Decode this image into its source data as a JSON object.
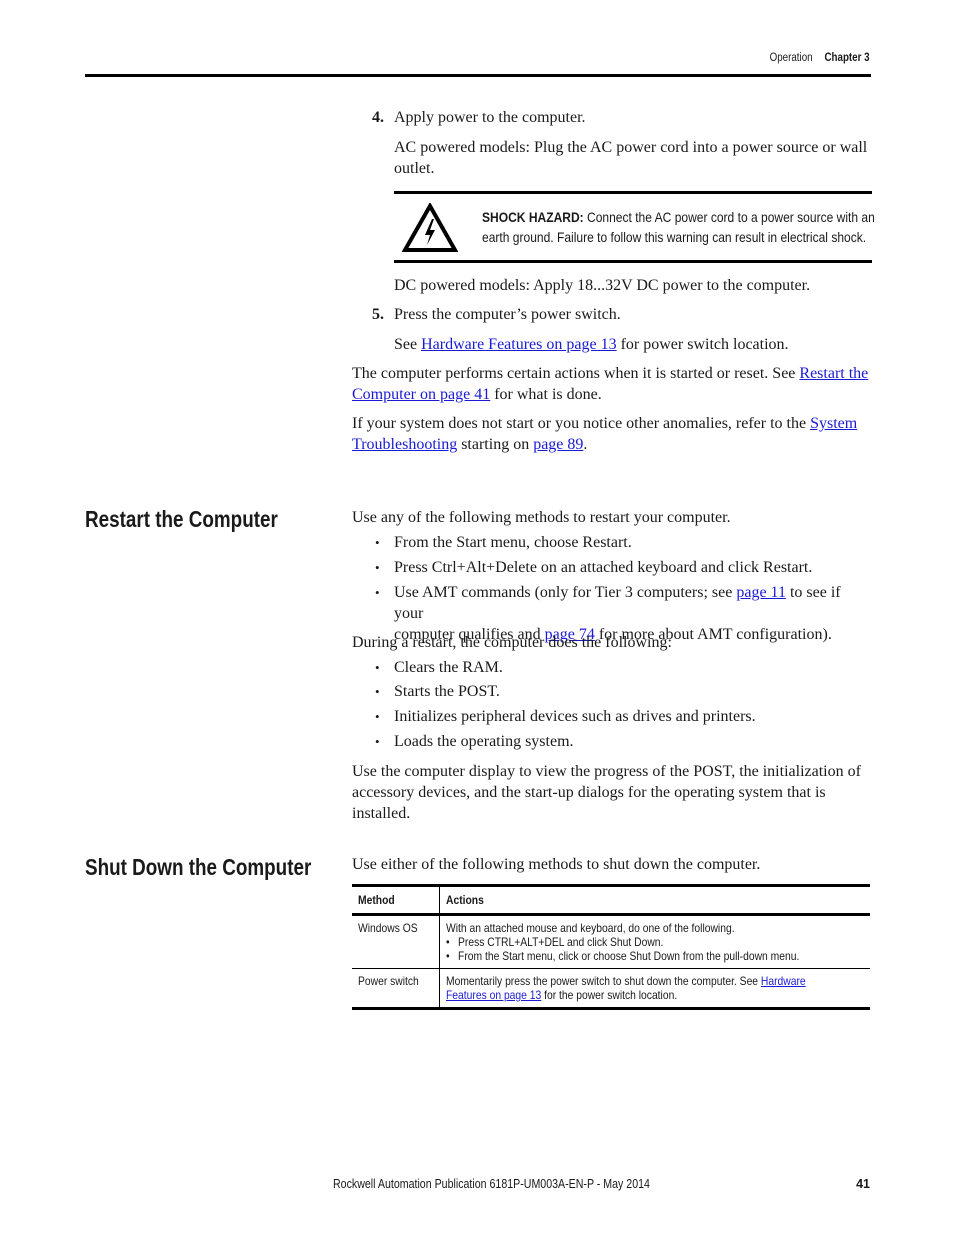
{
  "header": {
    "section": "Operation",
    "chapter": "Chapter 3"
  },
  "steps": {
    "step4": {
      "number": "4.",
      "text": "Apply power to the computer.",
      "ac_note": "AC powered models: Plug the AC power cord into a power source or wall outlet.",
      "hazard": {
        "icon": "shock-hazard-icon",
        "label": "SHOCK HAZARD:",
        "line1": " Connect the AC power cord to a power source with an",
        "line2": "earth ground. Failure to follow this warning can result in electrical shock."
      },
      "dc_note": "DC powered models: Apply 18...32V DC power to the computer."
    },
    "step5": {
      "number": "5.",
      "text": "Press the computer’s power switch.",
      "see_pre": "See ",
      "see_link": "Hardware Features on page 13",
      "see_post": " for power switch location."
    }
  },
  "para_actions": {
    "pre": "The computer performs certain actions when it is started or reset. See ",
    "link1": "Restart the",
    "link2": "Computer on page 41",
    "post": " for what is done."
  },
  "para_troubleshoot": {
    "pre": "If your system does not start or you notice other anomalies, refer to the ",
    "link1": "System",
    "link2": "Troubleshooting",
    "mid": " starting on ",
    "link3": "page 89",
    "post": "."
  },
  "restart": {
    "heading": "Restart the Computer",
    "intro": "Use any of the following methods to restart your computer.",
    "methods": [
      "From the Start menu, choose Restart.",
      "Press Ctrl+Alt+Delete on an attached keyboard and click Restart."
    ],
    "amt": {
      "pre": "Use AMT commands (only for Tier 3 computers; see ",
      "link1": "page 11",
      "mid1": " to see if your",
      "mid2": "computer qualifies and ",
      "link2": "page 74",
      "post": " for more about AMT configuration)."
    },
    "during_intro": "During a restart, the computer does the following:",
    "during": [
      "Clears the RAM.",
      "Starts the POST.",
      "Initializes peripheral devices such as drives and printers.",
      "Loads the operating system."
    ],
    "outro": "Use the computer display to view the progress of the POST, the initialization of accessory devices, and the start-up dialogs for the operating system that is installed."
  },
  "shutdown": {
    "heading": "Shut Down the Computer",
    "intro": "Use either of the following methods to shut down the computer.",
    "table": {
      "headers": [
        "Method",
        "Actions"
      ],
      "rows": [
        {
          "method": "Windows OS",
          "action": "With an attached mouse and keyboard, do one of the following.",
          "bullets": [
            "Press CTRL+ALT+DEL and click Shut Down.",
            "From the Start menu, click or choose Shut Down from the pull-down menu."
          ]
        },
        {
          "method": "Power switch",
          "action_pre": "Momentarily press the power switch to shut down the computer. See ",
          "action_link1": "Hardware",
          "action_link2": "Features on page 13",
          "action_post": " for the power switch location."
        }
      ]
    }
  },
  "footer": {
    "publication": "Rockwell Automation Publication 6181P-UM003A-EN-P - May 2014",
    "page_number": "41"
  }
}
